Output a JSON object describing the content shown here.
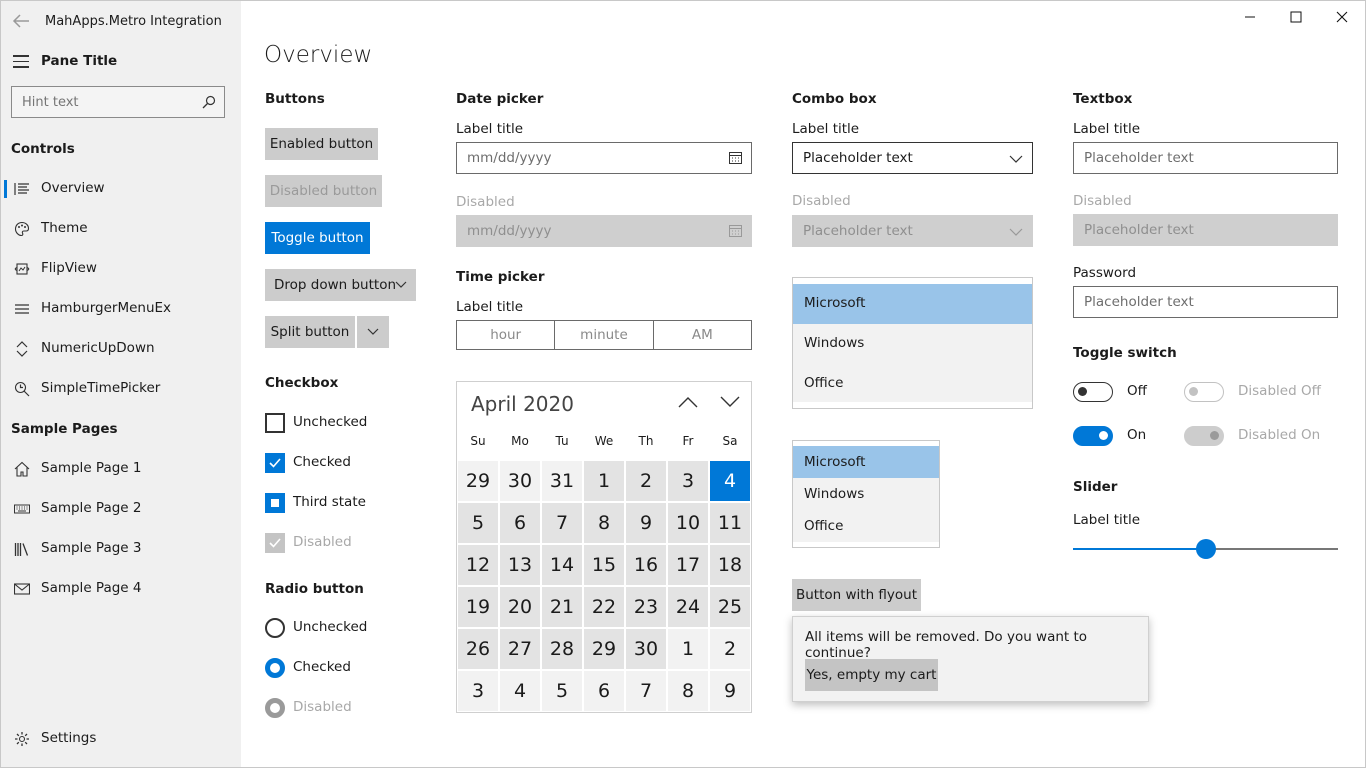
{
  "app": {
    "title": "MahApps.Metro Integration"
  },
  "sidebar": {
    "pane_title": "Pane Title",
    "search_placeholder": "Hint text",
    "controls_header": "Controls",
    "items": [
      {
        "label": "Overview",
        "icon": "list-icon"
      },
      {
        "label": "Theme",
        "icon": "palette-icon"
      },
      {
        "label": "FlipView",
        "icon": "flipview-icon"
      },
      {
        "label": "HamburgerMenuEx",
        "icon": "hamburger-icon"
      },
      {
        "label": "NumericUpDown",
        "icon": "updown-icon"
      },
      {
        "label": "SimpleTimePicker",
        "icon": "time-search-icon"
      }
    ],
    "samples_header": "Sample Pages",
    "samples": [
      {
        "label": "Sample Page 1",
        "icon": "home-icon"
      },
      {
        "label": "Sample Page 2",
        "icon": "keyboard-icon"
      },
      {
        "label": "Sample Page 3",
        "icon": "library-icon"
      },
      {
        "label": "Sample Page 4",
        "icon": "mail-icon"
      }
    ],
    "settings": "Settings"
  },
  "page": {
    "title": "Overview"
  },
  "buttons": {
    "header": "Buttons",
    "enabled": "Enabled button",
    "disabled": "Disabled button",
    "toggle": "Toggle button",
    "dropdown": "Drop down button",
    "split": "Split button"
  },
  "checkbox": {
    "header": "Checkbox",
    "unchecked": "Unchecked",
    "checked": "Checked",
    "third": "Third state",
    "disabled": "Disabled"
  },
  "radio": {
    "header": "Radio button",
    "unchecked": "Unchecked",
    "checked": "Checked",
    "disabled": "Disabled"
  },
  "datepicker": {
    "header": "Date picker",
    "label": "Label title",
    "placeholder": "mm/dd/yyyy",
    "disabled_label": "Disabled",
    "disabled_placeholder": "mm/dd/yyyy"
  },
  "timepicker": {
    "header": "Time picker",
    "label": "Label title",
    "hour": "hour",
    "minute": "minute",
    "ampm": "AM"
  },
  "calendar": {
    "month": "April 2020",
    "days_of_week": [
      "Su",
      "Mo",
      "Tu",
      "We",
      "Th",
      "Fr",
      "Sa"
    ],
    "weeks": [
      [
        "29",
        "30",
        "31",
        "1",
        "2",
        "3",
        "4"
      ],
      [
        "5",
        "6",
        "7",
        "8",
        "9",
        "10",
        "11"
      ],
      [
        "12",
        "13",
        "14",
        "15",
        "16",
        "17",
        "18"
      ],
      [
        "19",
        "20",
        "21",
        "22",
        "23",
        "24",
        "25"
      ],
      [
        "26",
        "27",
        "28",
        "29",
        "30",
        "1",
        "2"
      ],
      [
        "3",
        "4",
        "5",
        "6",
        "7",
        "8",
        "9"
      ]
    ],
    "selected_day": "4"
  },
  "combobox": {
    "header": "Combo box",
    "label": "Label title",
    "placeholder": "Placeholder text",
    "disabled_label": "Disabled",
    "disabled_placeholder": "Placeholder text",
    "list_items": [
      "Microsoft",
      "Windows",
      "Office"
    ],
    "list2_items": [
      "Microsoft",
      "Windows",
      "Office"
    ],
    "selected": "Microsoft"
  },
  "flyout": {
    "button": "Button with flyout",
    "message": "All items will be removed. Do you want to continue?",
    "confirm": "Yes, empty my cart"
  },
  "textbox": {
    "header": "Textbox",
    "label": "Label title",
    "placeholder": "Placeholder text",
    "disabled_label": "Disabled",
    "disabled_placeholder": "Placeholder text",
    "password_label": "Password",
    "password_placeholder": "Placeholder text"
  },
  "toggle": {
    "header": "Toggle switch",
    "off": "Off",
    "on": "On",
    "disabled_off": "Disabled Off",
    "disabled_on": "Disabled On"
  },
  "slider": {
    "header": "Slider",
    "label": "Label title",
    "value_fraction": 0.5
  },
  "colors": {
    "accent": "#0078d7",
    "sidebar_bg": "#f0f0f0",
    "selection": "#99c4e9"
  }
}
